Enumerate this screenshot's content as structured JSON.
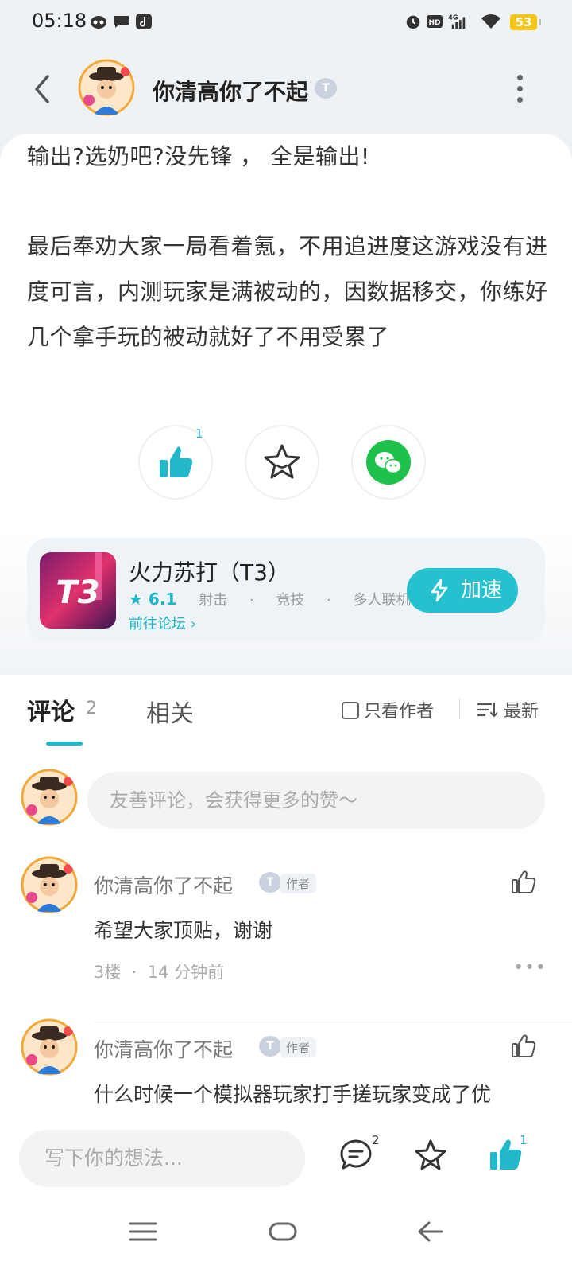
{
  "status_bar": {
    "time": "05:18",
    "battery": "53",
    "left_icons": [
      "bot-icon",
      "message-icon",
      "tiktok-icon"
    ],
    "right_icons": [
      "alarm-icon",
      "hd-icon",
      "signal-4g-icon",
      "wifi-icon",
      "battery-icon"
    ]
  },
  "header": {
    "username": "你清高你了不起",
    "badge": "T"
  },
  "article": {
    "line1": "输出?选奶吧?没先锋 ， 全是输出!",
    "paragraph": "最后奉劝大家一局看着氪，不用追进度这游戏没有进度可言，内测玩家是满被动的，因数据移交，你练好几个拿手玩的被动就好了不用受累了",
    "like_count": "1"
  },
  "game": {
    "name": "火力苏打（T3）",
    "icon_text": "T3",
    "score": "6.1",
    "tags": [
      "射击",
      "竞技",
      "多人联机"
    ],
    "forum_link": "前往论坛",
    "speed_button": "加速"
  },
  "comments_section": {
    "tab_comments": "评论",
    "comment_count": "2",
    "tab_related": "相关",
    "only_author": "只看作者",
    "sort": "最新",
    "input_placeholder": "友善评论，会获得更多的赞～",
    "items": [
      {
        "name": "你清高你了不起",
        "badge": "T",
        "author_tag": "作者",
        "text": "希望大家顶贴，谢谢",
        "floor": "3楼",
        "time": "14 分钟前"
      },
      {
        "name": "你清高你了不起",
        "badge": "T",
        "author_tag": "作者",
        "text": "什么时候一个模拟器玩家打手搓玩家变成了优"
      }
    ]
  },
  "bottom_bar": {
    "placeholder": "写下你的想法...",
    "comment_count": "2",
    "like_count": "1"
  },
  "colors": {
    "accent": "#22b7c9",
    "wechat": "#1ec14a",
    "battery": "#f5c518"
  }
}
